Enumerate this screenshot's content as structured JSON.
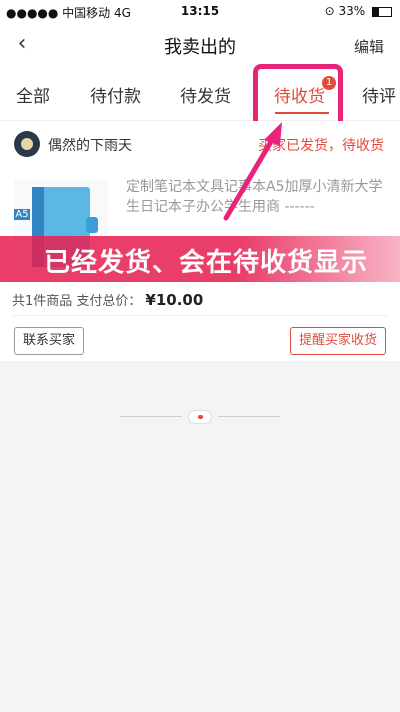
{
  "status_bar": {
    "carrier": "●●●●● 中国移动  4G",
    "time": "13:15",
    "battery": "33%"
  },
  "header": {
    "back_icon": "chevron-left-icon",
    "title": "我卖出的",
    "edit_label": "编辑"
  },
  "tabs": [
    {
      "label": "全部"
    },
    {
      "label": "待付款"
    },
    {
      "label": "待发货"
    },
    {
      "label": "待收货",
      "active": true,
      "badge": "1"
    },
    {
      "label": "待评"
    }
  ],
  "order": {
    "buyer_name": "偶然的下雨天",
    "status": "买家已发货，待收货",
    "product_title": "定制笔记本文具记事本A5加厚小清新大学生日记本子办公学生用商 ------",
    "product_image_label": "A5",
    "summary_prefix": "共1件商品 支付总价：",
    "price": "¥10.00",
    "contact_button": "联系买家",
    "remind_button": "提醒买家收货"
  },
  "annotation": {
    "banner_text": "已经发货、会在待收货显示",
    "highlight_color": "#e8237a"
  },
  "colors": {
    "accent": "#e24a3b"
  }
}
